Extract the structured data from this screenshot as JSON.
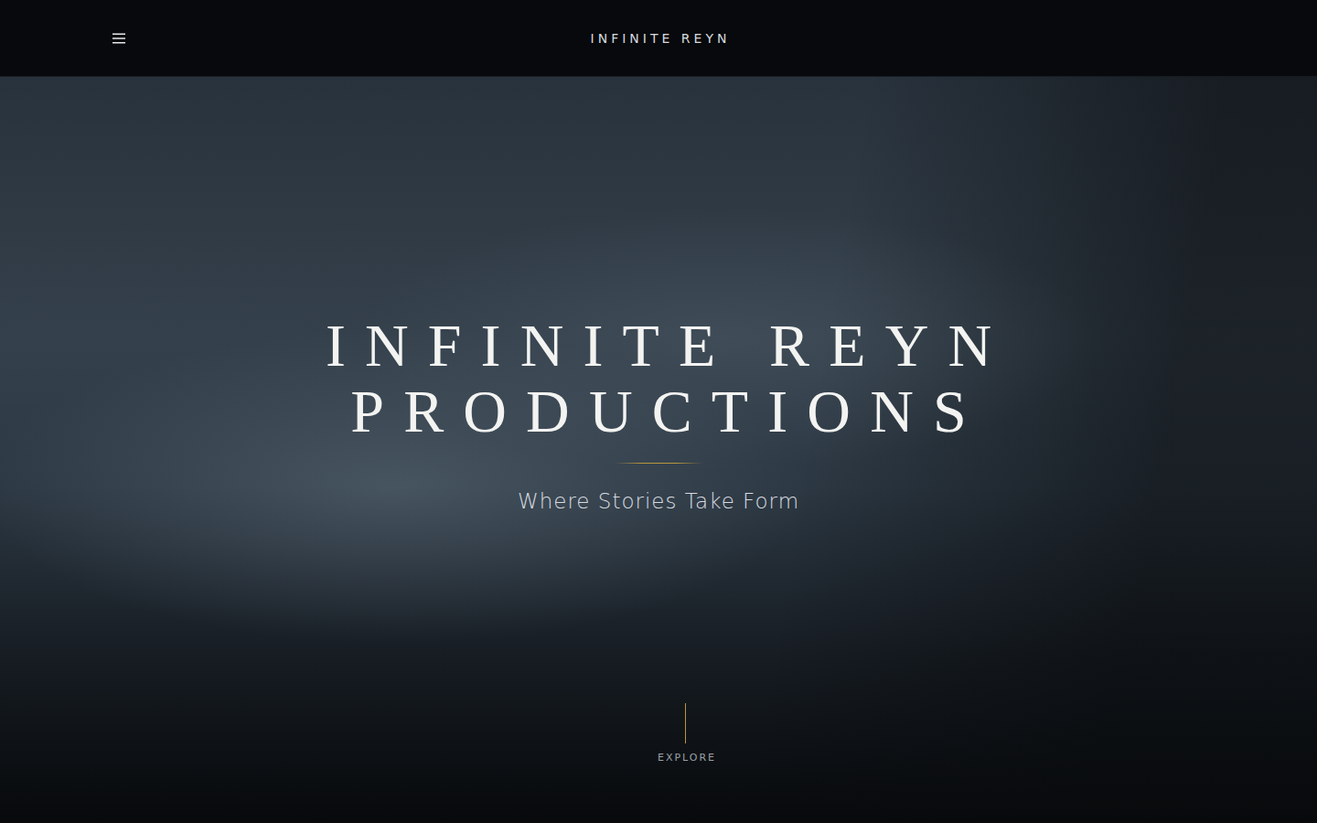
{
  "header": {
    "brand": "INFINITE REYN"
  },
  "hero": {
    "title_lines": [
      "INFINITE REYN",
      "PRODUCTIONS"
    ],
    "subtitle": "Where Stories Take Form"
  },
  "scroll_indicator": {
    "label": "EXPLORE"
  }
}
